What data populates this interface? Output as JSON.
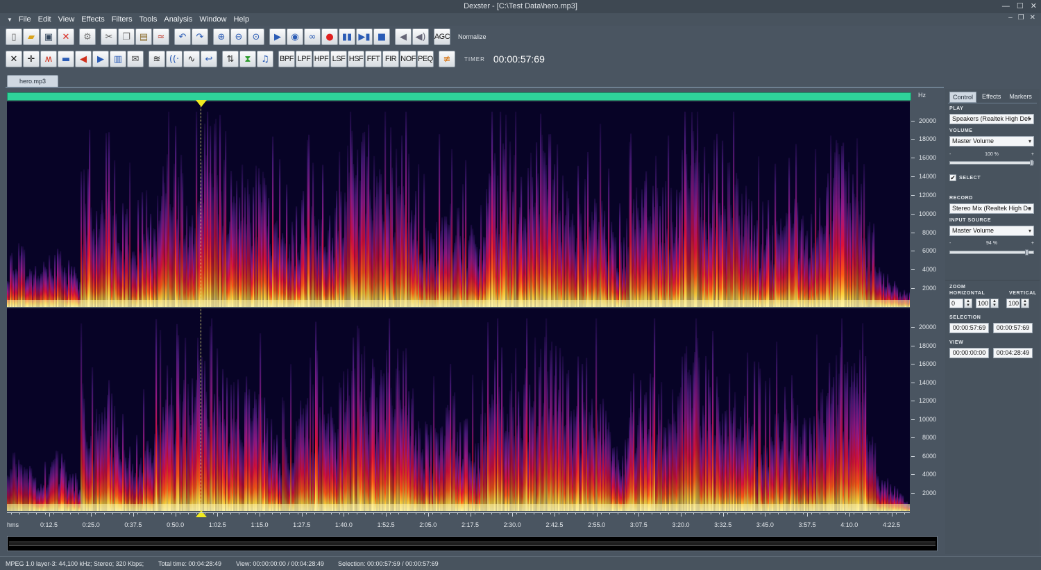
{
  "window": {
    "title": "Dexster - [C:\\Test Data\\hero.mp3]",
    "min": "—",
    "max": "☐",
    "close": "✕",
    "mdi_min": "–",
    "mdi_restore": "❐",
    "mdi_close": "✕"
  },
  "menu": [
    "File",
    "Edit",
    "View",
    "Effects",
    "Filters",
    "Tools",
    "Analysis",
    "Window",
    "Help"
  ],
  "toolbar1": {
    "buttons": [
      "new-icon",
      "open-icon",
      "save-icon",
      "close-file-icon",
      "settings-icon",
      "cut-icon",
      "copy-icon",
      "paste-icon",
      "mix-paste-icon",
      "undo-icon",
      "redo-icon",
      "zoom-in-icon",
      "zoom-out-icon",
      "zoom-fit-icon",
      "play-icon",
      "play-loop-icon",
      "loop-icon",
      "record-icon",
      "pause-icon",
      "forward-icon",
      "stop-icon",
      "volume-down-icon",
      "volume-up-icon"
    ],
    "agc": "AGC",
    "normalize": "Normalize"
  },
  "toolbar2": {
    "icons": [
      "expand-icon",
      "crop-icon",
      "noise-icon",
      "silence-icon",
      "fade-in-icon",
      "fade-out-icon",
      "amplify-icon",
      "envelope-icon",
      "echo-icon",
      "reverb-icon",
      "flanger-icon",
      "reverse-icon",
      "pitch-icon",
      "tempo-icon",
      "music-icon"
    ],
    "filters": [
      "BPF",
      "LPF",
      "HPF",
      "LSF",
      "HSF",
      "FFT",
      "FIR",
      "NOF",
      "PEQ"
    ],
    "timer_label": "TIMER",
    "timer": "00:00:57:69"
  },
  "document_tab": "hero.mp3",
  "hz_unit": "Hz",
  "hz_ticks": [
    "20000",
    "18000",
    "16000",
    "14000",
    "12000",
    "10000",
    "8000",
    "6000",
    "4000",
    "2000"
  ],
  "time_unit": "hms",
  "time_ticks": [
    "0:12.5",
    "0:25.0",
    "0:37.5",
    "0:50.0",
    "1:02.5",
    "1:15.0",
    "1:27.5",
    "1:40.0",
    "1:52.5",
    "2:05.0",
    "2:17.5",
    "2:30.0",
    "2:42.5",
    "2:55.0",
    "3:07.5",
    "3:20.0",
    "3:32.5",
    "3:45.0",
    "3:57.5",
    "4:10.0",
    "4:22.5"
  ],
  "cursor_time": "00:00:57:69",
  "panel": {
    "tabs": [
      "Control",
      "Effects",
      "Markers"
    ],
    "play_label": "PLAY",
    "play_device": "Speakers (Realtek High Def",
    "volume_label": "VOLUME",
    "volume_source": "Master Volume",
    "play_volume_pct": "100 %",
    "play_volume_value": 100,
    "select_label": "SELECT",
    "select_checked": "✔",
    "record_label": "RECORD",
    "record_device": "Stereo Mix (Realtek High De",
    "input_source_label": "INPUT SOURCE",
    "input_source": "Master Volume",
    "record_volume_pct": "94 %",
    "record_volume_value": 94,
    "minus": "-",
    "plus": "+",
    "zoom_label": "ZOOM",
    "horizontal_label": "HORIZONTAL",
    "vertical_label": "VERTICAL",
    "zoom_h_from": "0",
    "zoom_h_to": "100",
    "zoom_v": "100",
    "selection_label": "SELECTION",
    "selection_start": "00:00:57:69",
    "selection_end": "00:00:57:69",
    "view_label": "VIEW",
    "view_start": "00:00:00:00",
    "view_end": "00:04:28:49"
  },
  "status": {
    "format": "MPEG 1.0 layer-3: 44,100 kHz; Stereo; 320 Kbps;",
    "total": "Total time: 00:04:28:49",
    "view": "View: 00:00:00:00 / 00:04:28:49",
    "selection": "Selection: 00:00:57:69 / 00:00:57:69"
  }
}
